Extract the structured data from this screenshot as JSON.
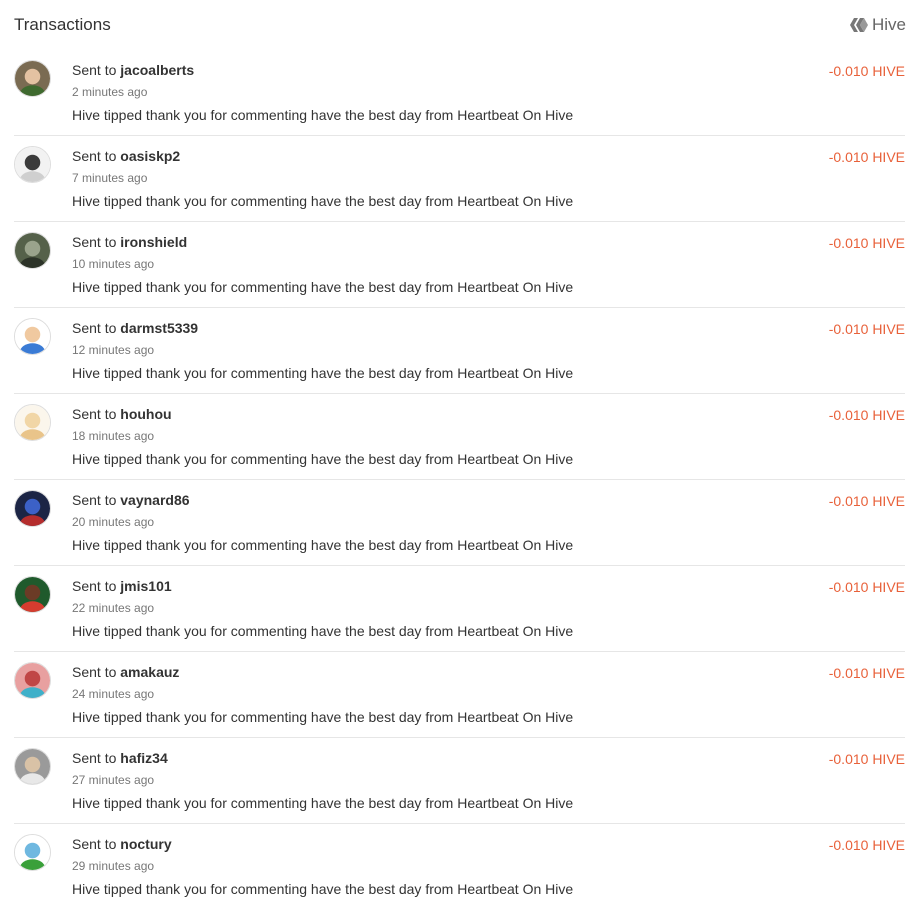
{
  "header": {
    "title": "Transactions",
    "brand_label": "Hive",
    "brand_icon": "hive-logo-icon"
  },
  "colors": {
    "amount": "#e8613a",
    "divider": "#e6e6e6"
  },
  "transactions": [
    {
      "prefix": "Sent to",
      "user": "jacoalberts",
      "time": "2 minutes ago",
      "memo": "Hive tipped thank you for commenting have the best day from Heartbeat On Hive",
      "amount": "-0.010 HIVE",
      "avatar": {
        "bg": "#7a6b52",
        "fg": "#e4c2a2",
        "accent": "#3f6a2f"
      }
    },
    {
      "prefix": "Sent to",
      "user": "oasiskp2",
      "time": "7 minutes ago",
      "memo": "Hive tipped thank you for commenting have the best day from Heartbeat On Hive",
      "amount": "-0.010 HIVE",
      "avatar": {
        "bg": "#f2f2f2",
        "fg": "#3b3b3b",
        "accent": "#cfcfcf"
      }
    },
    {
      "prefix": "Sent to",
      "user": "ironshield",
      "time": "10 minutes ago",
      "memo": "Hive tipped thank you for commenting have the best day from Heartbeat On Hive",
      "amount": "-0.010 HIVE",
      "avatar": {
        "bg": "#55614a",
        "fg": "#9aa38c",
        "accent": "#2c3328"
      }
    },
    {
      "prefix": "Sent to",
      "user": "darmst5339",
      "time": "12 minutes ago",
      "memo": "Hive tipped thank you for commenting have the best day from Heartbeat On Hive",
      "amount": "-0.010 HIVE",
      "avatar": {
        "bg": "#ffffff",
        "fg": "#f0c9a0",
        "accent": "#3a7bd5"
      }
    },
    {
      "prefix": "Sent to",
      "user": "houhou",
      "time": "18 minutes ago",
      "memo": "Hive tipped thank you for commenting have the best day from Heartbeat On Hive",
      "amount": "-0.010 HIVE",
      "avatar": {
        "bg": "#fbf6ec",
        "fg": "#f1d6a6",
        "accent": "#e9c48a"
      }
    },
    {
      "prefix": "Sent to",
      "user": "vaynard86",
      "time": "20 minutes ago",
      "memo": "Hive tipped thank you for commenting have the best day from Heartbeat On Hive",
      "amount": "-0.010 HIVE",
      "avatar": {
        "bg": "#1c2545",
        "fg": "#3c61c7",
        "accent": "#b52d2d"
      }
    },
    {
      "prefix": "Sent to",
      "user": "jmis101",
      "time": "22 minutes ago",
      "memo": "Hive tipped thank you for commenting have the best day from Heartbeat On Hive",
      "amount": "-0.010 HIVE",
      "avatar": {
        "bg": "#1f5a2c",
        "fg": "#6b3b26",
        "accent": "#d63c2f"
      }
    },
    {
      "prefix": "Sent to",
      "user": "amakauz",
      "time": "24 minutes ago",
      "memo": "Hive tipped thank you for commenting have the best day from Heartbeat On Hive",
      "amount": "-0.010 HIVE",
      "avatar": {
        "bg": "#e8a0a0",
        "fg": "#c04646",
        "accent": "#3fb0c9"
      }
    },
    {
      "prefix": "Sent to",
      "user": "hafiz34",
      "time": "27 minutes ago",
      "memo": "Hive tipped thank you for commenting have the best day from Heartbeat On Hive",
      "amount": "-0.010 HIVE",
      "avatar": {
        "bg": "#9a9a9a",
        "fg": "#d9c2a6",
        "accent": "#e8e8e8"
      }
    },
    {
      "prefix": "Sent to",
      "user": "noctury",
      "time": "29 minutes ago",
      "memo": "Hive tipped thank you for commenting have the best day from Heartbeat On Hive",
      "amount": "-0.010 HIVE",
      "avatar": {
        "bg": "#ffffff",
        "fg": "#6fb8e0",
        "accent": "#3aa03a"
      }
    }
  ]
}
